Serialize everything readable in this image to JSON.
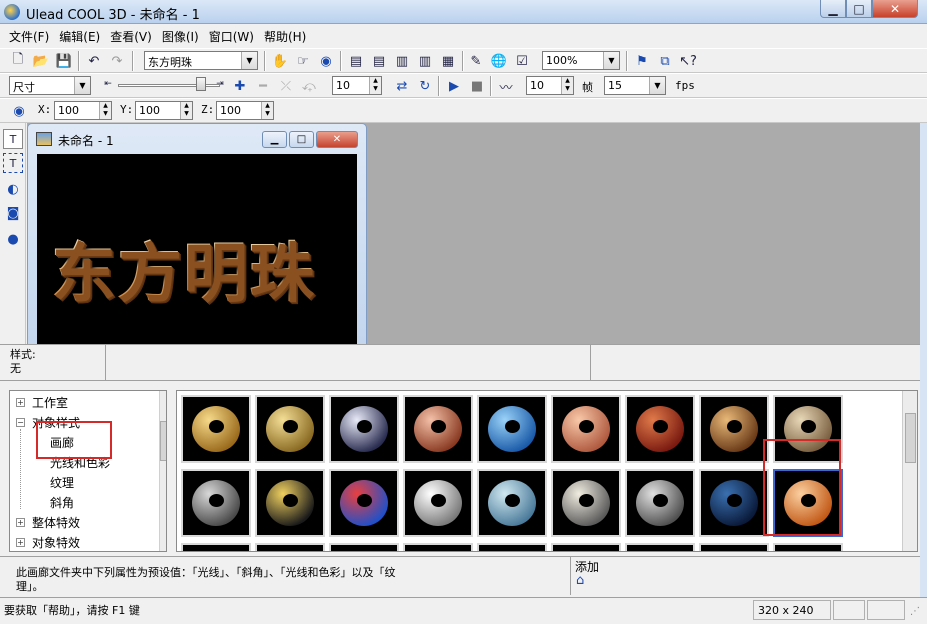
{
  "window": {
    "title": "Ulead COOL 3D - 未命名 - 1",
    "min_glyph": "▁",
    "max_glyph": "□",
    "close_glyph": "✕"
  },
  "menubar": [
    "文件(F)",
    "编辑(E)",
    "查看(V)",
    "图像(I)",
    "窗口(W)",
    "帮助(H)"
  ],
  "toolbar1": {
    "font_combo": "东方明珠",
    "zoom_combo": "100%"
  },
  "toolbar2": {
    "attr_combo": "尺寸",
    "frame_value": "10",
    "step_value": "10",
    "frames_label": "帧",
    "fps_value": "15",
    "fps_label": "fps"
  },
  "toolbar3": {
    "x_label": "X:",
    "x_value": "100",
    "y_label": "Y:",
    "y_value": "100",
    "z_label": "Z:",
    "z_value": "100"
  },
  "document": {
    "title": "未命名 - 1",
    "text": "东方明珠"
  },
  "infostrip": {
    "style_label": "样式:",
    "style_value": "无"
  },
  "tree": {
    "items": [
      {
        "label": "工作室",
        "expander": "+"
      },
      {
        "label": "对象样式",
        "expander": "−"
      },
      {
        "label": "画廊",
        "expander": ""
      },
      {
        "label": "光线和色彩",
        "expander": ""
      },
      {
        "label": "纹理",
        "expander": ""
      },
      {
        "label": "斜角",
        "expander": ""
      },
      {
        "label": "整体特效",
        "expander": "+"
      },
      {
        "label": "对象特效",
        "expander": "+"
      }
    ]
  },
  "gallery": {
    "thumbnails": [
      {
        "name": "gold-ring",
        "color1": "#f6d98a",
        "color2": "#9a6a1c"
      },
      {
        "name": "gold-ring-2",
        "color1": "#f4de96",
        "color2": "#8a6a22"
      },
      {
        "name": "chrome-ring",
        "color1": "#e8eaf8",
        "color2": "#2a2c50"
      },
      {
        "name": "copper-ring",
        "color1": "#f4c0a8",
        "color2": "#8a3a22"
      },
      {
        "name": "blue-texture-ring",
        "color1": "#9ad2f8",
        "color2": "#1a5aa8"
      },
      {
        "name": "pink-clay-ring",
        "color1": "#f8c8a8",
        "color2": "#b05a40"
      },
      {
        "name": "red-pattern-ring",
        "color1": "#e07a4a",
        "color2": "#7a1a10"
      },
      {
        "name": "leopard-ring",
        "color1": "#e8b878",
        "color2": "#6a3a18"
      },
      {
        "name": "stone-ring",
        "color1": "#e8d8b8",
        "color2": "#7a6040"
      },
      {
        "name": "gray-speckle-ring",
        "color1": "#d8d8d8",
        "color2": "#4a4a4a"
      },
      {
        "name": "black-gold-ring",
        "color1": "#f0d060",
        "color2": "#1a1a1a"
      },
      {
        "name": "multicolor-ring",
        "color1": "#e84040",
        "color2": "#2050c8"
      },
      {
        "name": "white-marble-ring",
        "color1": "#ffffff",
        "color2": "#7a7a7a"
      },
      {
        "name": "glass-blue-ring",
        "color1": "#d0e8f0",
        "color2": "#4a7a9a"
      },
      {
        "name": "pearl-ring",
        "color1": "#f0ece0",
        "color2": "#5a5a5a"
      },
      {
        "name": "silver-studs-ring",
        "color1": "#e0e0e0",
        "color2": "#505050"
      },
      {
        "name": "dark-blue-ring",
        "color1": "#3a70b0",
        "color2": "#0a1a3a"
      },
      {
        "name": "orange-ring",
        "color1": "#fbd0a0",
        "color2": "#c25a18"
      },
      {
        "name": "row3-a",
        "color1": "#e08a4a",
        "color2": "#5a2a10"
      },
      {
        "name": "row3-b",
        "color1": "#6ab06a",
        "color2": "#1a3a1a"
      },
      {
        "name": "row3-c",
        "color1": "#e0a0a0",
        "color2": "#5a2a2a"
      },
      {
        "name": "row3-d",
        "color1": "#a8a0e0",
        "color2": "#2a2a5a"
      },
      {
        "name": "row3-e",
        "color1": "#f0d080",
        "color2": "#6a4a10"
      },
      {
        "name": "row3-f",
        "color1": "#c0c0c0",
        "color2": "#303030"
      },
      {
        "name": "row3-g",
        "color1": "#e0c0a0",
        "color2": "#5a3a20"
      },
      {
        "name": "row3-h",
        "color1": "#80b0e0",
        "color2": "#1a3050"
      },
      {
        "name": "row3-i",
        "color1": "#d8d8d8",
        "color2": "#505050"
      }
    ]
  },
  "description": {
    "text_line1": "此画廊文件夹中下列属性为预设值：「光线」、「斜角」、「光线和色彩」以及「纹",
    "text_line2": "理」。",
    "add_label": "添加"
  },
  "statusbar": {
    "hint": "要获取「帮助」，请按 F1 键",
    "size": "320 x 240"
  },
  "colors": {
    "highlight_box": "#d42a2a",
    "workspace": "#ababab",
    "text_gold": "#d8a060"
  }
}
